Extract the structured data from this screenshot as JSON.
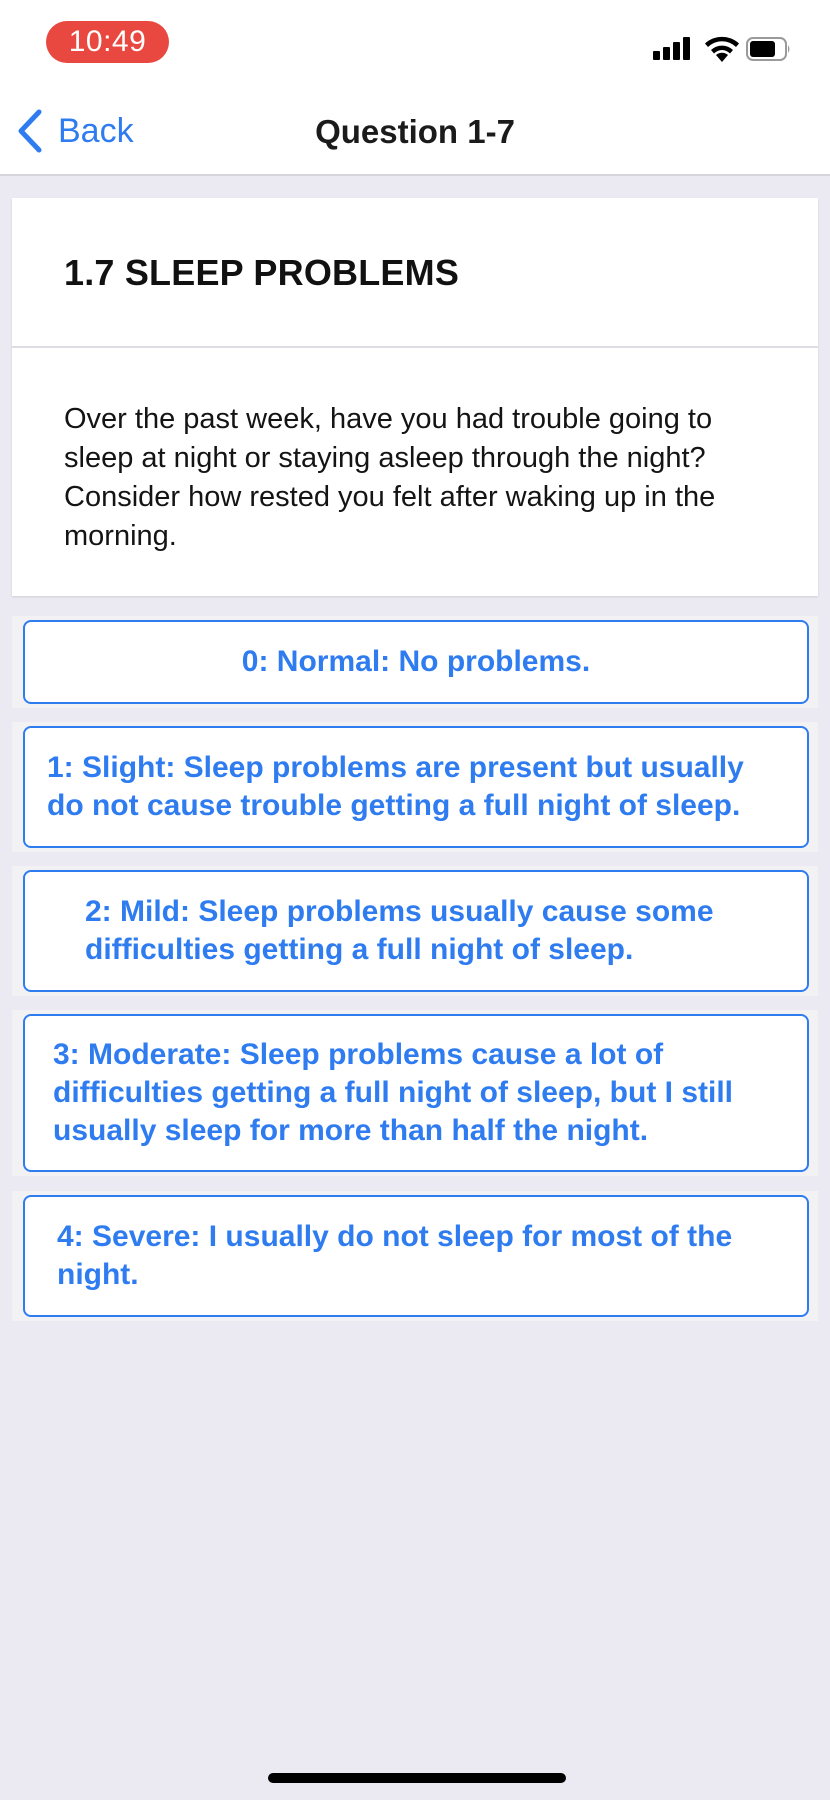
{
  "status_bar": {
    "time": "10:49"
  },
  "nav": {
    "back_label": "Back",
    "title": "Question 1-7"
  },
  "question": {
    "heading": "1.7 SLEEP PROBLEMS",
    "text": "Over the past week, have you had trouble going to sleep at night or staying asleep through the night? Consider how rested you felt after waking up in the morning."
  },
  "answers": [
    {
      "label": "0: Normal: No problems."
    },
    {
      "label": "1: Slight: Sleep problems are present but usually do not cause trouble getting a full night of sleep."
    },
    {
      "label": "2: Mild: Sleep problems usually cause some difficulties getting a full night of sleep."
    },
    {
      "label": "3: Moderate: Sleep problems cause a lot of difficulties getting a full night of sleep, but I still usually sleep for more than half the night."
    },
    {
      "label": "4: Severe: I usually do not sleep for most of the night."
    }
  ],
  "colors": {
    "accent": "#2f7cf0",
    "time_pill": "#e8483f",
    "background": "#ebeaf3"
  }
}
